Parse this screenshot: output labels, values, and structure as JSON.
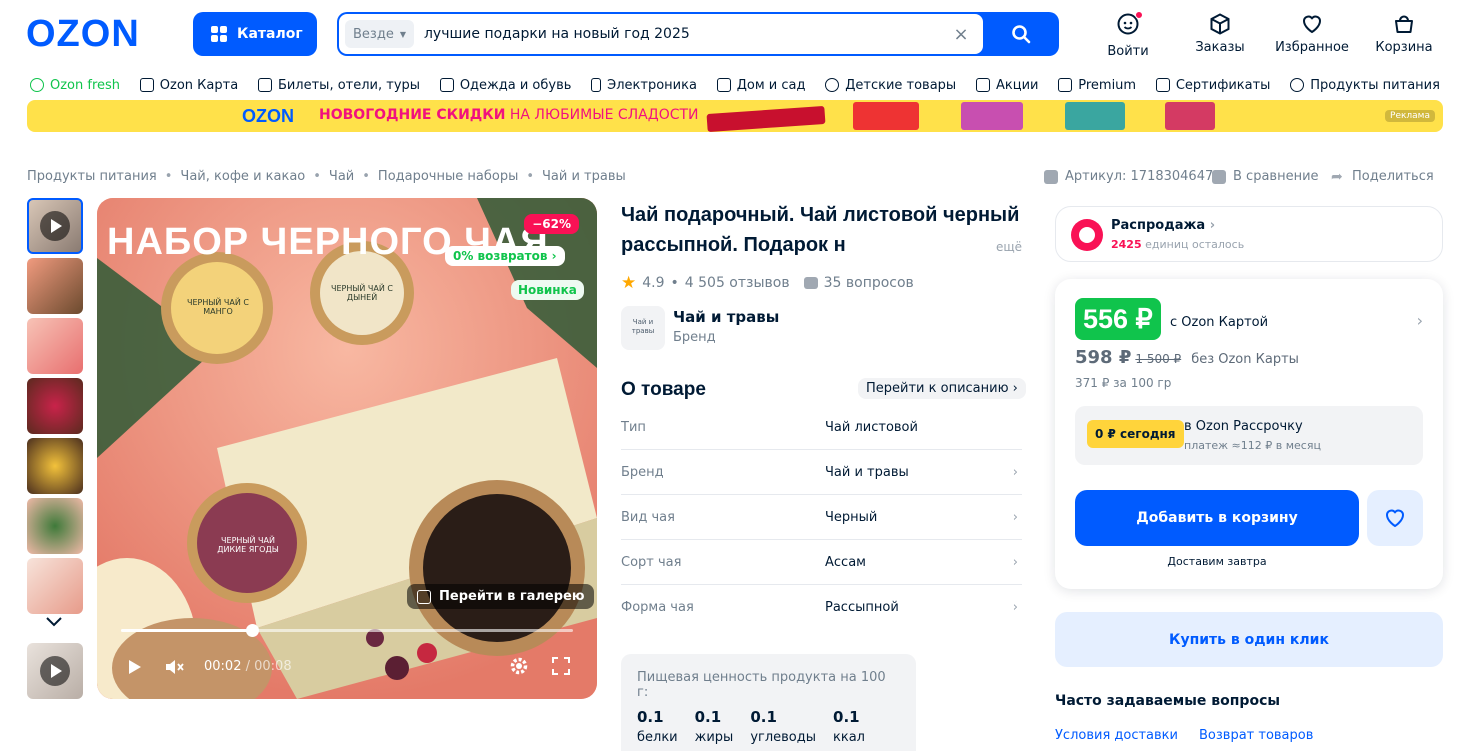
{
  "header": {
    "logo": "OZON",
    "catalog_label": "Каталог",
    "search_scope": "Везде",
    "search_query": "лучшие подарки на новый год 2025",
    "login": "Войти",
    "orders": "Заказы",
    "favorites": "Избранное",
    "cart": "Корзина"
  },
  "nav": [
    "Ozon fresh",
    "Ozon Карта",
    "Билеты, отели, туры",
    "Одежда и обувь",
    "Электроника",
    "Дом и сад",
    "Детские товары",
    "Акции",
    "Premium",
    "Сертификаты",
    "Продукты питания"
  ],
  "banner": {
    "brand": "OZON",
    "headline": "НОВОГОДНИЕ СКИДКИ",
    "tail": " НА ЛЮБИМЫЕ СЛАДОСТИ",
    "ad_label": "Реклама"
  },
  "breadcrumbs": [
    "Продукты питания",
    "Чай, кофе и какао",
    "Чай",
    "Подарочные наборы",
    "Чай и травы"
  ],
  "meta": {
    "sku": "Артикул: 1718304647",
    "compare": "В сравнение",
    "share": "Поделиться"
  },
  "media": {
    "hero_text": "НАБОР ЧЕРНОГО ЧАЯ",
    "discount": "−62%",
    "returns": "0% возвратов",
    "new_badge": "Новинка",
    "gallery_link": "Перейти в галерею",
    "time_current": "00:02",
    "time_total": "/ 00:08",
    "progress": 0.29,
    "jar_labels": [
      "ЧЕРНЫЙ ЧАЙ С МАНГО",
      "ЧЕРНЫЙ ЧАЙ С ДЫНЕЙ",
      "ЧЕРНЫЙ ЧАЙ ДИКИЕ ЯГОДЫ"
    ]
  },
  "product": {
    "title": "Чай подарочный. Чай листовой черный рассыпной. Подарок н",
    "more": "ещё",
    "rating": "4.9",
    "reviews": "4 505 отзывов",
    "questions": "35 вопросов",
    "brand_name": "Чай и травы",
    "brand_label": "Бренд",
    "brand_logo_text": "Чай и травы"
  },
  "about": {
    "title": "О товаре",
    "to_description": "Перейти к описанию",
    "specs": [
      {
        "k": "Тип",
        "v": "Чай листовой"
      },
      {
        "k": "Бренд",
        "v": "Чай и травы"
      },
      {
        "k": "Вид чая",
        "v": "Черный"
      },
      {
        "k": "Сорт чая",
        "v": "Ассам"
      },
      {
        "k": "Форма чая",
        "v": "Рассыпной"
      }
    ]
  },
  "nutrition": {
    "title": "Пищевая ценность продукта на 100 г:",
    "items": [
      {
        "v": "0.1",
        "l": "белки"
      },
      {
        "v": "0.1",
        "l": "жиры"
      },
      {
        "v": "0.1",
        "l": "углеводы"
      },
      {
        "v": "0.1",
        "l": "ккал"
      }
    ]
  },
  "offer": {
    "sale_title": "Распродажа",
    "sale_count": "2425",
    "sale_rest": " единиц осталось",
    "price_card": "556 ₽",
    "price_card_label": "с Ozon Картой",
    "price_regular": "598 ₽",
    "price_old": "1 500 ₽",
    "price_regular_label": "без Ozon Карты",
    "unit_price": "371 ₽ за 100 гр",
    "installment_badge": "0 ₽ сегодня",
    "installment_title": "в Ozon Рассрочку",
    "installment_sub": "платеж ≈112 ₽ в месяц",
    "add_to_cart": "Добавить в корзину",
    "delivery": "Доставим завтра",
    "one_click": "Купить в один клик"
  },
  "faq": {
    "title": "Часто задаваемые вопросы",
    "links": [
      "Условия доставки",
      "Возврат товаров"
    ]
  },
  "colors": {
    "brand": "#005bff",
    "accent": "#f91155",
    "green": "#10c44c"
  }
}
